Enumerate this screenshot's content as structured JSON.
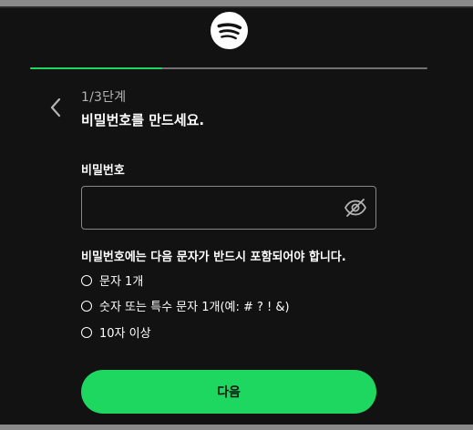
{
  "branding": {
    "logo_icon": "spotify-logo-icon",
    "accent_color": "#1ed760"
  },
  "progress": {
    "current_step": 1,
    "total_steps": 3,
    "fraction": 0.333
  },
  "header": {
    "back_icon": "chevron-left-icon",
    "step_label": "1/3단계",
    "title": "비밀번호를 만드세요."
  },
  "form": {
    "password_label": "비밀번호",
    "password_value": "",
    "toggle_icon": "eye-off-icon"
  },
  "requirements": {
    "heading": "비밀번호에는 다음 문자가 반드시 포함되어야 합니다.",
    "items": [
      {
        "label": "문자 1개",
        "met": false
      },
      {
        "label": "숫자 또는 특수 문자 1개(예: # ? ! &)",
        "met": false
      },
      {
        "label": "10자 이상",
        "met": false
      }
    ]
  },
  "actions": {
    "next_label": "다음"
  }
}
